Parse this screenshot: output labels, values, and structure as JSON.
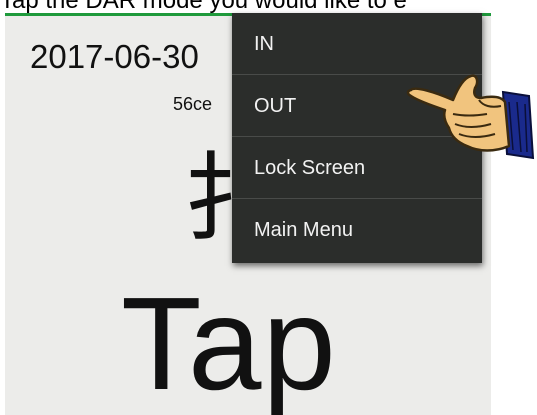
{
  "instruction": "Tap the DAR mode you would like to e",
  "screen": {
    "date": "2017-06-30",
    "id_fragment": "56ce",
    "character": "扌",
    "tap_label": "Tap"
  },
  "menu": {
    "items": [
      {
        "label": "IN"
      },
      {
        "label": "OUT"
      },
      {
        "label": "Lock Screen"
      },
      {
        "label": "Main Menu"
      }
    ]
  },
  "colors": {
    "status_bar": "#1f9a3c",
    "menu_bg": "#2b2d2b",
    "screen_bg": "#ececea"
  },
  "icons": {
    "pointer": "pointing-hand-icon"
  }
}
